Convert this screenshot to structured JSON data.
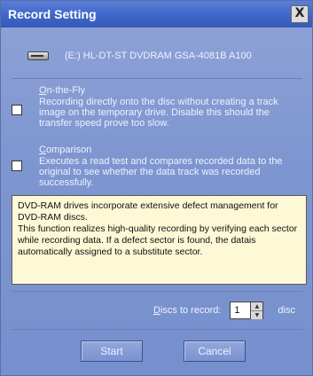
{
  "window": {
    "title": "Record Setting",
    "close_glyph": "X"
  },
  "drive": {
    "icon": "drive-icon",
    "label": "(E:) HL-DT-ST DVDRAM GSA-4081B A100"
  },
  "options": [
    {
      "title_underlined": "O",
      "title_rest": "n-the-Fly",
      "description": "Recording directly onto the disc without creating a track image on the temporary drive. Disable this should the transfer speed prove too slow.",
      "checked": false
    },
    {
      "title_underlined": "C",
      "title_rest": "omparison",
      "description": "Executes a read test and compares recorded data to the original to see whether the data track was recorded successfully.",
      "checked": false
    }
  ],
  "info": {
    "paragraph1": "DVD-RAM drives incorporate extensive defect management for DVD-RAM discs.",
    "paragraph2": "This function realizes high-quality recording by verifying each sector while recording data. If a defect sector is found, the datais automatically assigned to a substitute sector."
  },
  "discs": {
    "label_underlined": "D",
    "label_rest": "iscs to record:",
    "value": "1",
    "unit": "disc"
  },
  "buttons": {
    "start": "Start",
    "cancel": "Cancel"
  }
}
